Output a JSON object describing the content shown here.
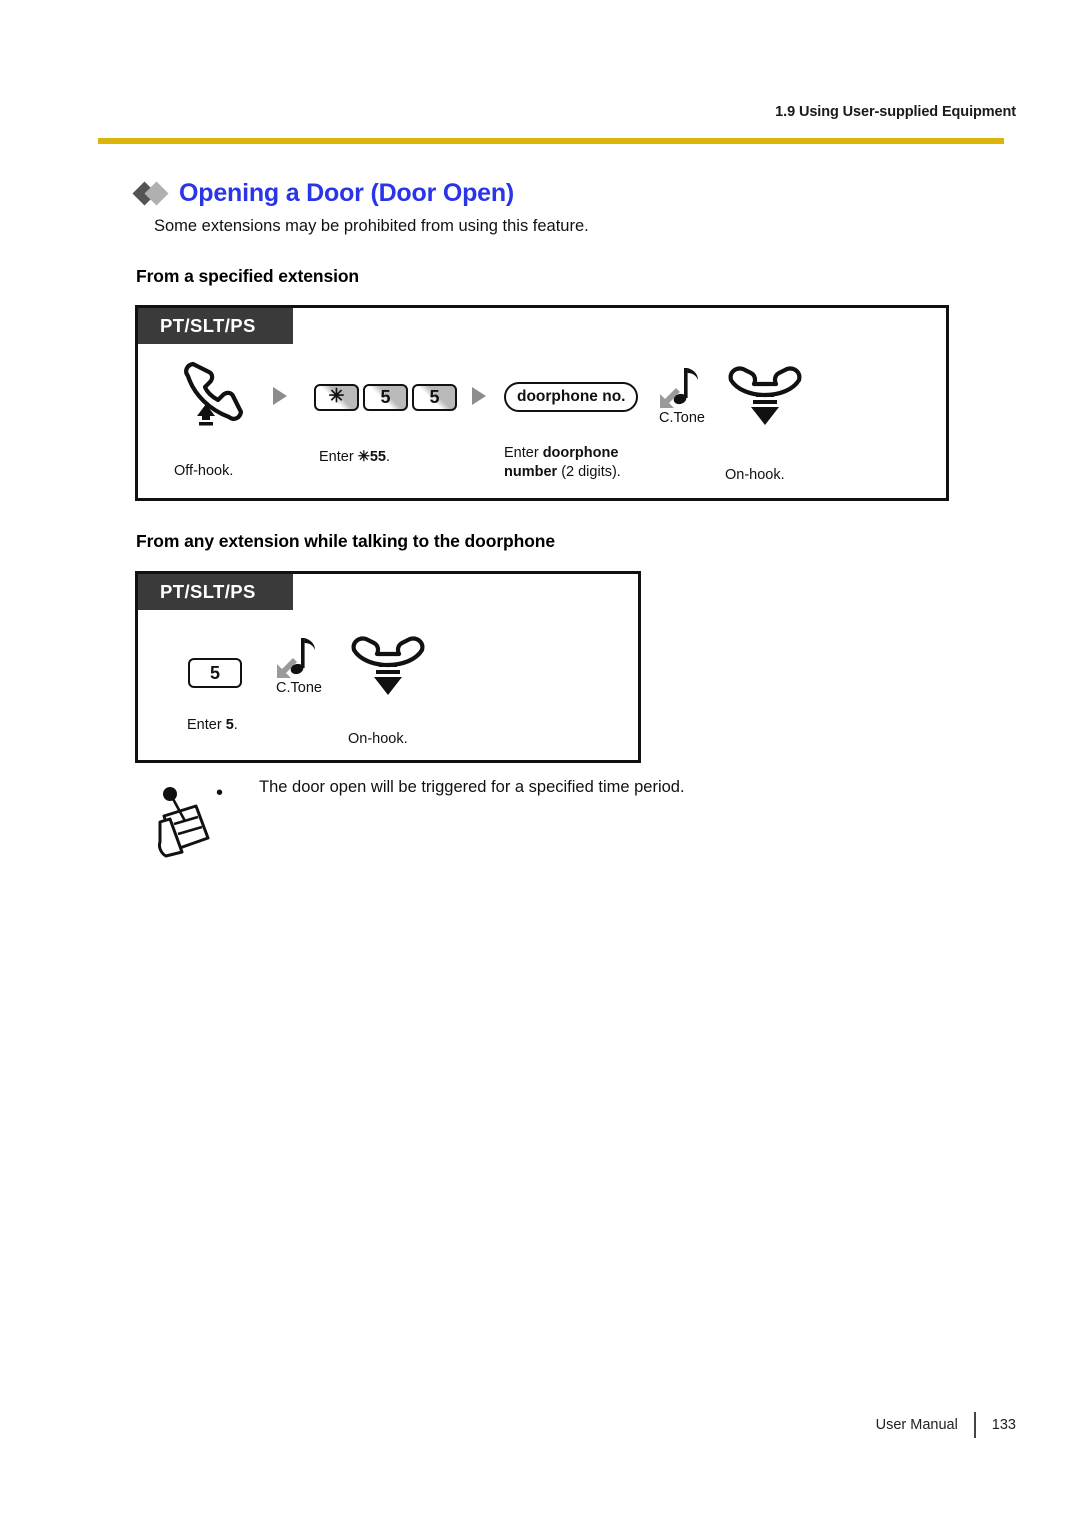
{
  "header": {
    "title": "1.9 Using User-supplied Equipment",
    "rule_color": "#dcb40a"
  },
  "section": {
    "title": "Opening a Door (Door Open)",
    "title_color": "#2b35e8",
    "diamond_dark": "#545454",
    "diamond_light": "#b0b0b0",
    "intro": "Some extensions may be prohibited from using this feature."
  },
  "procedures": [
    {
      "heading": "From a specified extension",
      "device_tag": "PT/SLT/PS",
      "steps": [
        {
          "glyph": "offhook-handset-icon",
          "caption": "Off-hook."
        },
        {
          "glyph": "keypad-star-5-5",
          "keys": [
            "✳",
            "5",
            "5"
          ],
          "caption_prefix": "Enter ",
          "caption_bold": "✳55",
          "caption_suffix": "."
        },
        {
          "glyph": "doorphone-pill",
          "pill_label": "doorphone no.",
          "caption_prefix": "Enter ",
          "caption_bold": "doorphone number",
          "caption_suffix": " (2 digits)."
        },
        {
          "glyph": "confirmation-tone-icon",
          "tone_label": "C.Tone"
        },
        {
          "glyph": "onhook-handset-icon",
          "caption": "On-hook."
        }
      ]
    },
    {
      "heading": "From any extension while talking to the doorphone",
      "device_tag": "PT/SLT/PS",
      "steps": [
        {
          "glyph": "key-5",
          "keys": [
            "5"
          ],
          "caption_prefix": "Enter ",
          "caption_bold": "5",
          "caption_suffix": "."
        },
        {
          "glyph": "confirmation-tone-icon",
          "tone_label": "C.Tone"
        },
        {
          "glyph": "onhook-handset-icon",
          "caption": "On-hook."
        }
      ]
    }
  ],
  "note": {
    "icon": "note-memo-icon",
    "bullet": "•",
    "text": "The door open will be triggered for a specified time period."
  },
  "footer": {
    "label": "User Manual",
    "page_number": "133"
  }
}
